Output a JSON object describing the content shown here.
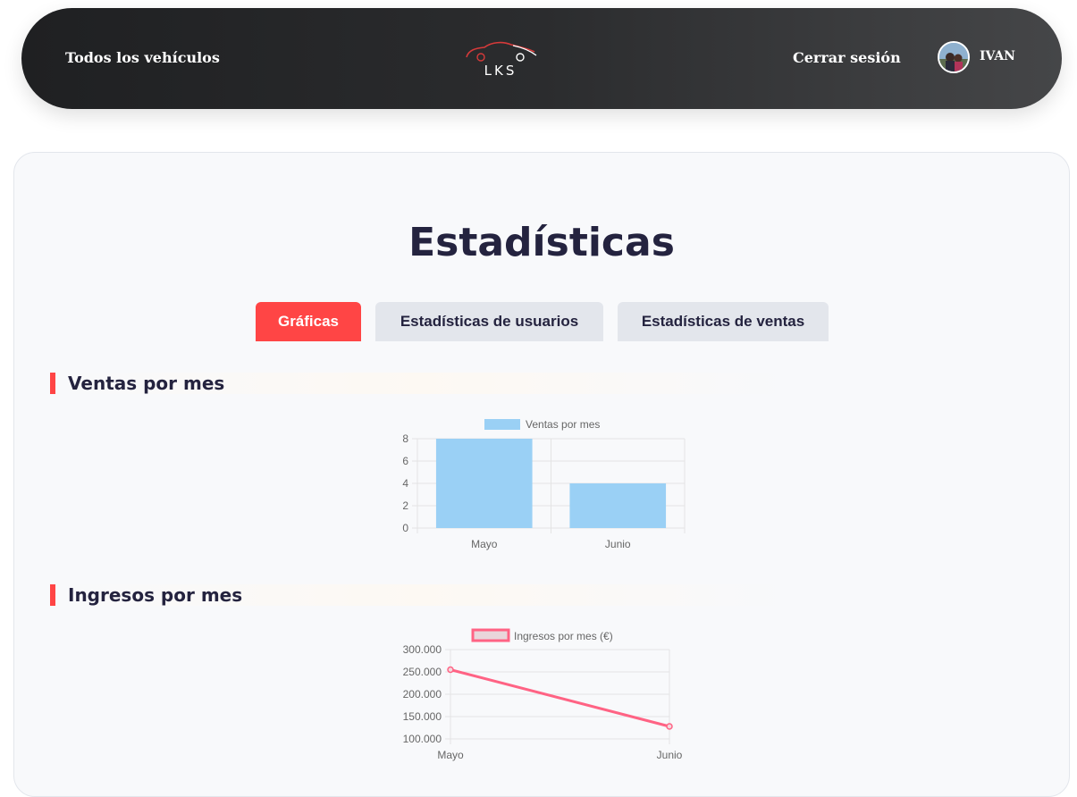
{
  "nav": {
    "all_vehicles": "Todos los vehículos",
    "logo_text": "LKS",
    "logout": "Cerrar sesión",
    "user_name": "IVAN"
  },
  "page": {
    "title": "Estadísticas",
    "tabs": [
      {
        "label": "Gráficas",
        "active": true
      },
      {
        "label": "Estadísticas de usuarios",
        "active": false
      },
      {
        "label": "Estadísticas de ventas",
        "active": false
      }
    ]
  },
  "colors": {
    "accent": "#ff4545",
    "bar_fill": "#9ad0f5",
    "line": "#ff6384"
  },
  "sections": {
    "sales_title": "Ventas por mes",
    "income_title": "Ingresos por mes"
  },
  "chart_data": [
    {
      "type": "bar",
      "title": "",
      "legend": "Ventas por mes",
      "legend_position": "top",
      "categories": [
        "Mayo",
        "Junio"
      ],
      "values": [
        8,
        4
      ],
      "ylim": [
        0,
        8
      ],
      "yticks": [
        "0",
        "2",
        "4",
        "6",
        "8"
      ],
      "grid": true
    },
    {
      "type": "line",
      "title": "",
      "legend": "Ingresos por mes (€)",
      "legend_position": "top",
      "categories": [
        "Mayo",
        "Junio"
      ],
      "values": [
        255000,
        128000
      ],
      "ylim": [
        100000,
        300000
      ],
      "yticks": [
        "100.000",
        "150.000",
        "200.000",
        "250.000",
        "300.000"
      ],
      "grid": true
    }
  ]
}
